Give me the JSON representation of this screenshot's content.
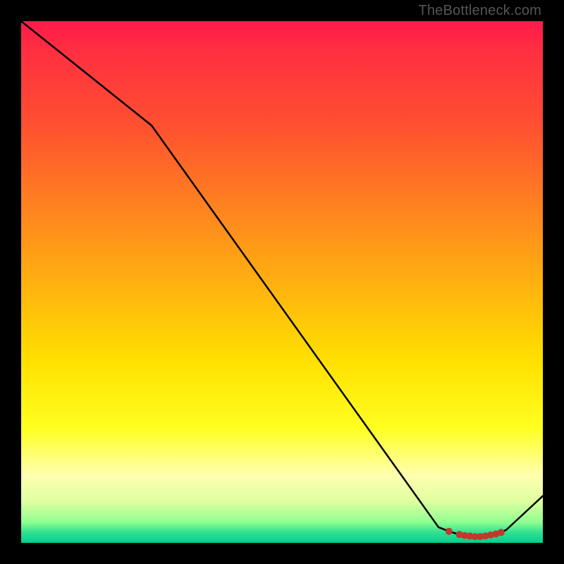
{
  "watermark": "TheBottleneck.com",
  "chart_data": {
    "type": "line",
    "title": "",
    "xlabel": "",
    "ylabel": "",
    "xlim": [
      0,
      100
    ],
    "ylim": [
      0,
      100
    ],
    "series": [
      {
        "name": "curve",
        "x": [
          0,
          25,
          80,
          82,
          84,
          85,
          86,
          87,
          88,
          89,
          90,
          91,
          92,
          93,
          100
        ],
        "values": [
          100,
          80,
          3,
          2.2,
          1.6,
          1.4,
          1.3,
          1.2,
          1.2,
          1.3,
          1.5,
          1.7,
          2.0,
          2.5,
          9
        ]
      }
    ],
    "markers": {
      "name": "highlight-points",
      "color": "#c0392b",
      "x": [
        82,
        84,
        85,
        86,
        87,
        88,
        89,
        90,
        91,
        92
      ],
      "values": [
        2.2,
        1.6,
        1.4,
        1.3,
        1.2,
        1.2,
        1.3,
        1.5,
        1.7,
        2.0
      ]
    },
    "gradient_stops": [
      {
        "pos": 0,
        "color": "#ff1a4a"
      },
      {
        "pos": 6,
        "color": "#ff3040"
      },
      {
        "pos": 20,
        "color": "#ff5030"
      },
      {
        "pos": 35,
        "color": "#ff8020"
      },
      {
        "pos": 50,
        "color": "#ffb010"
      },
      {
        "pos": 65,
        "color": "#ffe000"
      },
      {
        "pos": 78,
        "color": "#ffff20"
      },
      {
        "pos": 87,
        "color": "#ffffb0"
      },
      {
        "pos": 92,
        "color": "#e0ffa0"
      },
      {
        "pos": 96,
        "color": "#90ff90"
      },
      {
        "pos": 98,
        "color": "#30e090"
      },
      {
        "pos": 100,
        "color": "#00d090"
      }
    ]
  }
}
